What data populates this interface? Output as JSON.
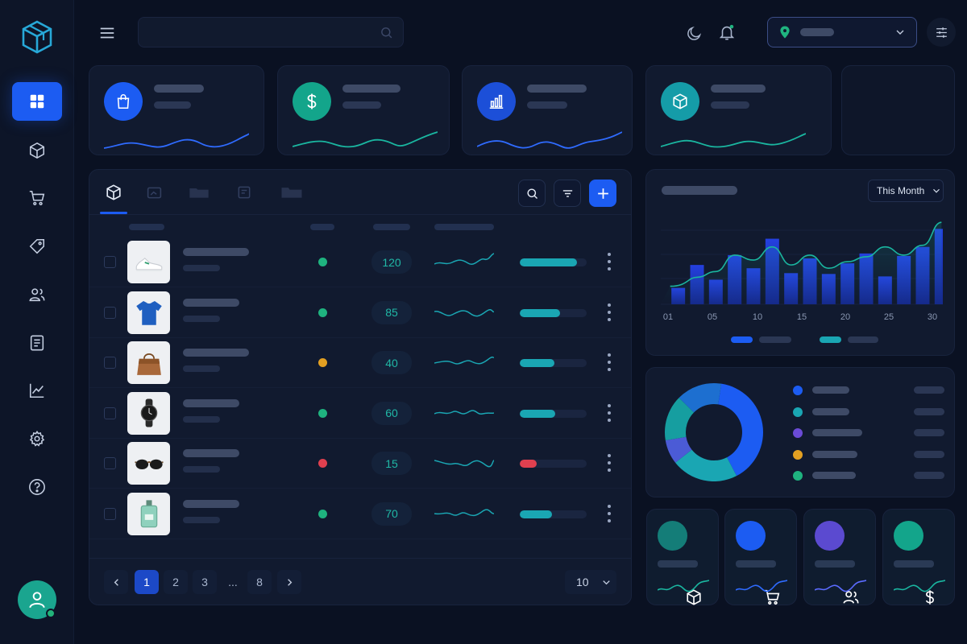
{
  "sidebar": {
    "logo_icon": "cube-logo-icon",
    "items": [
      {
        "icon": "dashboard-grid-icon",
        "active": true
      },
      {
        "icon": "package-icon",
        "active": false
      },
      {
        "icon": "cart-icon",
        "active": false
      },
      {
        "icon": "tag-icon",
        "active": false
      },
      {
        "icon": "users-icon",
        "active": false
      },
      {
        "icon": "document-icon",
        "active": false
      },
      {
        "icon": "analytics-icon",
        "active": false
      },
      {
        "icon": "settings-gear-icon",
        "active": false
      },
      {
        "icon": "help-icon",
        "active": false
      }
    ],
    "avatar_icon": "user-avatar-icon"
  },
  "topbar": {
    "menu_icon": "hamburger-menu-icon",
    "search_icon": "search-icon",
    "theme_icon": "moon-icon",
    "notification_icon": "bell-icon",
    "location_icon": "location-pin-icon",
    "settings_icon": "sliders-icon"
  },
  "stats": [
    {
      "icon": "shopping-bag-icon",
      "color": "#1c5cf2",
      "line": "#2f6bff"
    },
    {
      "icon": "dollar-icon",
      "color": "#13a58b",
      "line": "#1ab6a0"
    },
    {
      "icon": "bar-chart-icon",
      "color": "#1c4fd8",
      "line": "#2f6bff"
    },
    {
      "icon": "box-icon",
      "color": "#159ca8",
      "line": "#1ab6a0"
    }
  ],
  "products": {
    "rows": [
      {
        "thumb": "sneaker",
        "status_color": "#1fb37f",
        "quantity": "120",
        "progress": 0.85,
        "bar_color": "#1aa6b3"
      },
      {
        "thumb": "tshirt",
        "status_color": "#1fb37f",
        "quantity": "85",
        "progress": 0.6,
        "bar_color": "#1aa6b3"
      },
      {
        "thumb": "handbag",
        "status_color": "#e3a022",
        "quantity": "40",
        "progress": 0.52,
        "bar_color": "#1aa6b3"
      },
      {
        "thumb": "watch",
        "status_color": "#1fb37f",
        "quantity": "60",
        "progress": 0.53,
        "bar_color": "#1aa6b3"
      },
      {
        "thumb": "sunglasses",
        "status_color": "#e0404f",
        "quantity": "15",
        "progress": 0.25,
        "bar_color": "#e0404f"
      },
      {
        "thumb": "perfume",
        "status_color": "#1fb37f",
        "quantity": "70",
        "progress": 0.48,
        "bar_color": "#1aa6b3"
      }
    ],
    "pagination": {
      "prev_icon": "chevron-left-icon",
      "pages": [
        "1",
        "2",
        "3",
        "...",
        "8"
      ],
      "active": "1",
      "next_icon": "chevron-right-icon",
      "per_page": "10"
    }
  },
  "chart": {
    "period": "This Month",
    "xticks": [
      "01",
      "05",
      "10",
      "15",
      "20",
      "25",
      "30"
    ]
  },
  "chart_data": {
    "type": "bar",
    "x": [
      1,
      3,
      5,
      7,
      9,
      11,
      13,
      15,
      17,
      19,
      21,
      23,
      25,
      27,
      29
    ],
    "series": [
      {
        "type": "bar",
        "values": [
          20,
          48,
          30,
          60,
          44,
          80,
          38,
          56,
          37,
          50,
          62,
          34,
          59,
          70,
          92
        ]
      },
      {
        "type": "line",
        "values": [
          22,
          33,
          40,
          60,
          54,
          70,
          48,
          60,
          44,
          52,
          58,
          70,
          60,
          72,
          100
        ]
      }
    ],
    "ylim": [
      0,
      110
    ]
  },
  "donut": {
    "segments": [
      {
        "color": "#1c5cf2",
        "value": 40
      },
      {
        "color": "#1aa6b3",
        "value": 22
      },
      {
        "color": "#4b5bd6",
        "value": 8
      },
      {
        "color": "#169ea0",
        "value": 15
      },
      {
        "color": "#1d6fd0",
        "value": 15
      }
    ],
    "legend_colors": [
      "#1c5cf2",
      "#1aa6b3",
      "#6b4bd6",
      "#e3a022",
      "#1fb37f"
    ]
  },
  "mini_cards": [
    {
      "icon": "box-icon",
      "color": "#147d78",
      "line": "#1ab6a0"
    },
    {
      "icon": "cart-icon",
      "color": "#1c5cf2",
      "line": "#2f6bff"
    },
    {
      "icon": "users-icon",
      "color": "#5b4ad0",
      "line": "#5b6bff"
    },
    {
      "icon": "dollar-icon",
      "color": "#13a58b",
      "line": "#1ab6a0"
    }
  ]
}
